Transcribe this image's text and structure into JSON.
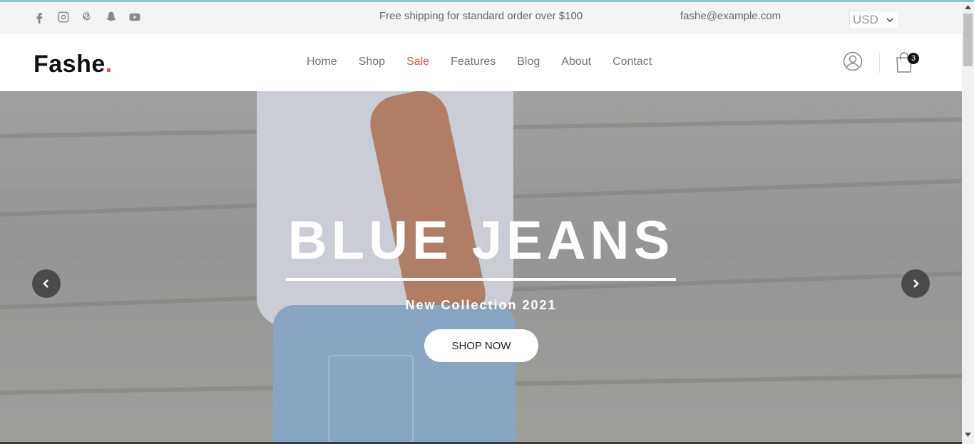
{
  "topbar": {
    "social_icons": [
      "facebook-icon",
      "instagram-icon",
      "pinterest-icon",
      "snapchat-icon",
      "youtube-icon"
    ],
    "promo": "Free shipping for standard order over $100",
    "email": "fashe@example.com",
    "currency": "USD"
  },
  "header": {
    "logo": "Fashe",
    "logo_dot": ".",
    "nav": [
      "Home",
      "Shop",
      "Sale",
      "Features",
      "Blog",
      "About",
      "Contact"
    ],
    "cart_count": "3"
  },
  "hero": {
    "title": "BLUE JEANS",
    "subtitle": "New Collection 2021",
    "cta": "SHOP NOW"
  },
  "colors": {
    "accent": "#e65540",
    "topbar_bg": "#f4f4f4",
    "arrow_bg": "#4a4a4a"
  }
}
